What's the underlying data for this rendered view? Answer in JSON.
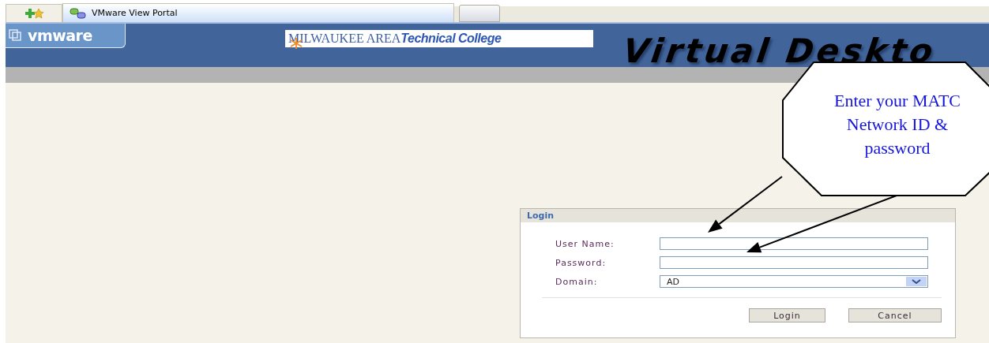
{
  "browser": {
    "tabs": [
      {
        "title": "VMware View Portal",
        "selected": true
      }
    ]
  },
  "header": {
    "brand": "vmware",
    "college_prefix": "MILWAUKEE AREA",
    "college_name": "Technical College",
    "banner": "Virtual Deskto"
  },
  "callout": {
    "text": "Enter your MATC Network ID & password"
  },
  "login": {
    "title": "Login",
    "fields": [
      {
        "kind": "text",
        "label": "User Name:"
      },
      {
        "kind": "password",
        "label": "Password:"
      },
      {
        "kind": "select",
        "label": "Domain:",
        "value": "AD"
      }
    ],
    "buttons": [
      "Login",
      "Cancel"
    ]
  }
}
